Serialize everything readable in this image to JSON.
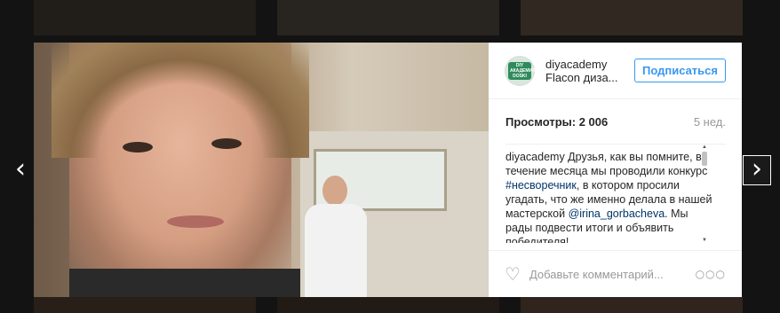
{
  "navigation": {
    "prev_icon": "‹",
    "next_icon": "›"
  },
  "post": {
    "username": "diyacademy",
    "location": "Flacon диза...",
    "follow_label": "Подписаться",
    "avatar_text": "DIY АКАДЕМИЯ DOSKI",
    "views": "Просмотры: 2 006",
    "age": "5 нед.",
    "caption": {
      "author": "diyacademy",
      "text_1": " Друзья, как вы помните, в течение месяца мы проводили конкурс ",
      "hashtag": "#несворечник",
      "text_2": ", в котором просили угадать, что же именно делала в нашей мастерской ",
      "mention": "@irina_gorbacheva",
      "text_3": ". Мы рады подвести итоги и объявить победителя!"
    },
    "comment_placeholder": "Добавьте комментарий...",
    "heart_icon": "♡",
    "more_icon": "○○○"
  },
  "colors": {
    "accent": "#3897f0",
    "link": "#003569",
    "muted": "#999999",
    "text": "#262626"
  }
}
